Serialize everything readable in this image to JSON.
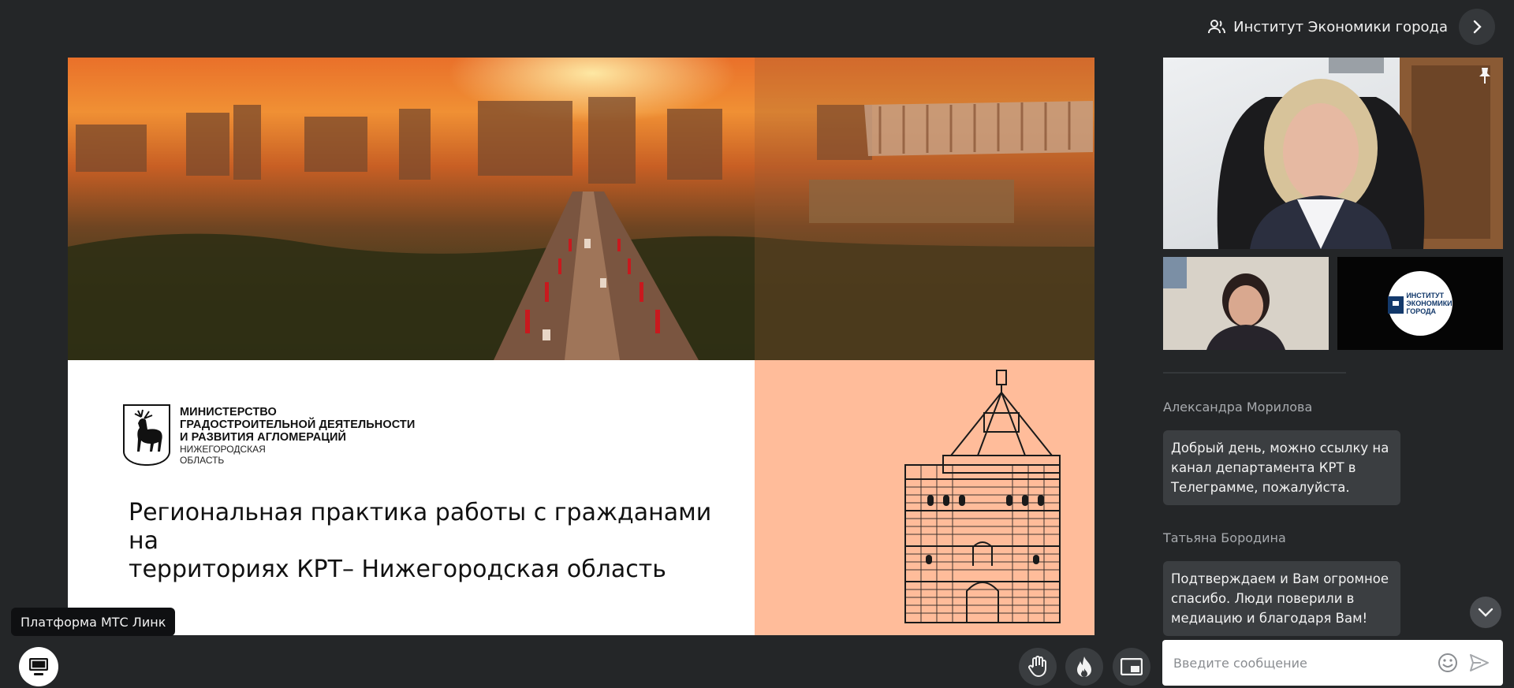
{
  "header": {
    "organization": "Институт Экономики города"
  },
  "slide": {
    "ministry_lines": [
      "МИНИСТЕРСТВО",
      "ГРАДОСТРОИТЕЛЬНОЙ ДЕЯТЕЛЬНОСТИ",
      "И РАЗВИТИЯ АГЛОМЕРАЦИЙ"
    ],
    "region_lines": [
      "НИЖЕГОРОДСКАЯ",
      "ОБЛАСТЬ"
    ],
    "title_lines": [
      "Региональная практика работы с гражданами на",
      "территориях КРТ– Нижегородская область"
    ]
  },
  "participants": {
    "logo_tile_lines": [
      "ИНСТИТУТ",
      "ЭКОНОМИКИ",
      "ГОРОДА"
    ]
  },
  "chat": {
    "messages": [
      {
        "author": "Александра Морилова",
        "lines": [
          "Добрый день, можно ссылку на",
          "канал департамента КРТ в",
          "Телеграмме, пожалуйста."
        ]
      },
      {
        "author": "Татьяна Бородина",
        "lines": [
          "Подтверждаем и Вам огромное",
          "спасибо. Люди поверили в",
          "медиацию и благодаря Вам!"
        ]
      }
    ],
    "input_placeholder": "Введите сообщение"
  },
  "tooltip": {
    "text": "Платформа МТС Линк"
  },
  "colors": {
    "background": "#242628",
    "slide_peach": "#ffbc9a",
    "chat_bubble": "#3b3e41"
  },
  "icons": {
    "header": [
      "users-icon",
      "chevron-right-icon"
    ],
    "toolbar": [
      "raise-hand-icon",
      "fire-reaction-icon",
      "picture-in-picture-icon"
    ],
    "bottom_left": "screen-share-icon",
    "message_box": [
      "emoji-icon",
      "send-icon"
    ],
    "video": "pin-icon",
    "chat": "chevron-down-icon"
  }
}
